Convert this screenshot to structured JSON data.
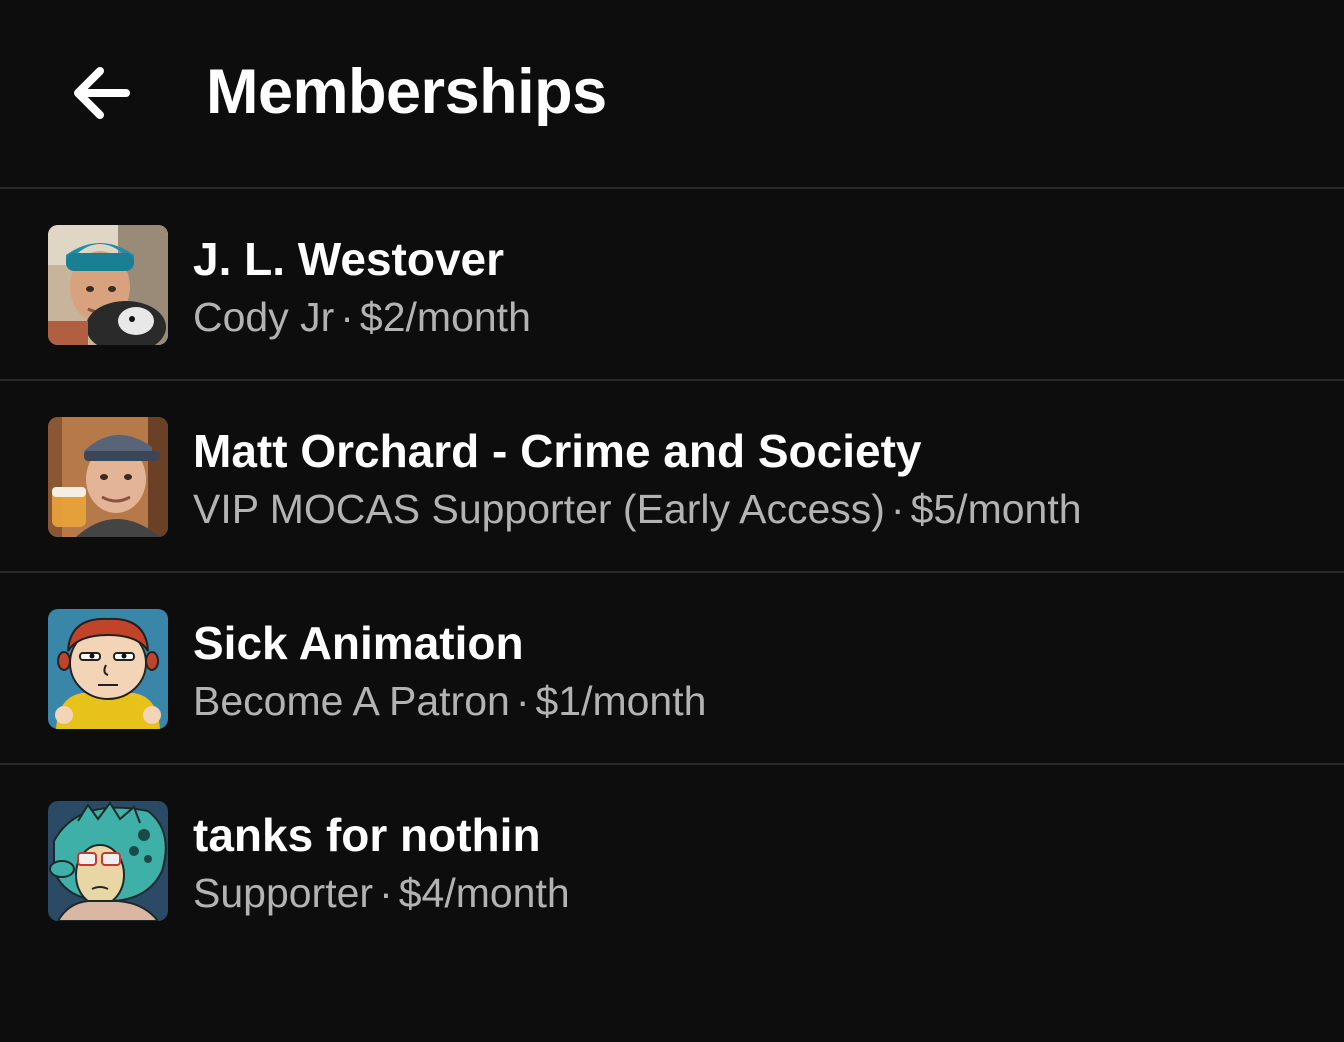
{
  "header": {
    "title": "Memberships",
    "back_icon": "arrow-left-icon"
  },
  "memberships": [
    {
      "creator": "J. L. Westover",
      "tier": "Cody Jr",
      "separator": "·",
      "price": "$2/month"
    },
    {
      "creator": "Matt Orchard - Crime and Society",
      "tier": "VIP MOCAS Supporter (Early Access)",
      "separator": "·",
      "price": "$5/month"
    },
    {
      "creator": "Sick Animation",
      "tier": "Become A Patron",
      "separator": "·",
      "price": "$1/month"
    },
    {
      "creator": "tanks for nothin",
      "tier": "Supporter",
      "separator": "·",
      "price": "$4/month"
    }
  ],
  "colors": {
    "background": "#0d0d0d",
    "primary_text": "#ffffff",
    "secondary_text": "#b3b3b3",
    "divider": "#2a2a2a"
  }
}
